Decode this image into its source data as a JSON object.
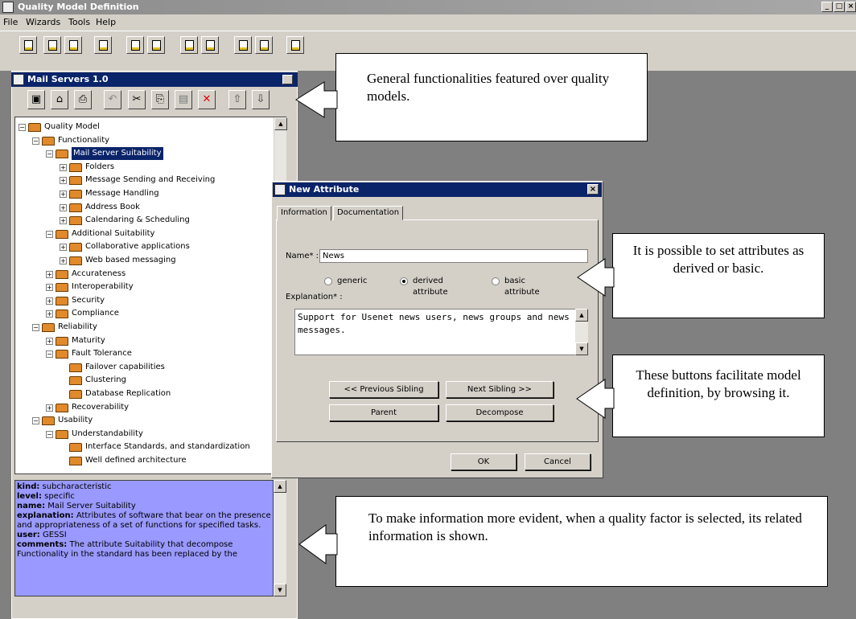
{
  "app": {
    "title": "Quality Model Definition",
    "window_buttons": [
      "_",
      "□",
      "×"
    ]
  },
  "menu": [
    "File",
    "Wizards",
    "Tools",
    "Help"
  ],
  "toolbar_icons": [
    "new-icon",
    "open-icon",
    "edit-icon",
    "edit-alt-icon",
    "page-icon",
    "image-icon",
    "copy-doc-icon",
    "paste-doc-icon",
    "check-doc-icon",
    "settings-icon",
    "book-icon"
  ],
  "inner_window": {
    "title": "Mail Servers 1.0",
    "toolbar": [
      {
        "name": "save-icon",
        "glyph": "▣"
      },
      {
        "name": "open-icon",
        "glyph": "⌂"
      },
      {
        "name": "print-icon",
        "glyph": "⎙"
      },
      {
        "name": "undo-icon",
        "glyph": "↶"
      },
      {
        "name": "cut-icon",
        "glyph": "✂"
      },
      {
        "name": "copy-icon",
        "glyph": "⎘"
      },
      {
        "name": "paste-icon",
        "glyph": "▤"
      },
      {
        "name": "delete-icon",
        "glyph": "✕"
      },
      {
        "name": "up-arrow-icon",
        "glyph": "⇧"
      },
      {
        "name": "down-arrow-icon",
        "glyph": "⇩"
      }
    ]
  },
  "tree": [
    {
      "label": "Quality Model",
      "level": 0,
      "pm": "−"
    },
    {
      "label": "Functionality",
      "level": 1,
      "pm": "−"
    },
    {
      "label": "Mail Server Suitability",
      "level": 2,
      "pm": "−",
      "selected": true
    },
    {
      "label": "Folders",
      "level": 3,
      "pm": "+"
    },
    {
      "label": "Message Sending and Receiving",
      "level": 3,
      "pm": "+"
    },
    {
      "label": "Message Handling",
      "level": 3,
      "pm": "+"
    },
    {
      "label": "Address Book",
      "level": 3,
      "pm": "+"
    },
    {
      "label": "Calendaring & Scheduling",
      "level": 3,
      "pm": "+"
    },
    {
      "label": "Additional Suitability",
      "level": 2,
      "pm": "−"
    },
    {
      "label": "Collaborative applications",
      "level": 3,
      "pm": "+"
    },
    {
      "label": "Web based messaging",
      "level": 3,
      "pm": "+"
    },
    {
      "label": "Accurateness",
      "level": 2,
      "pm": "+"
    },
    {
      "label": "Interoperability",
      "level": 2,
      "pm": "+"
    },
    {
      "label": "Security",
      "level": 2,
      "pm": "+"
    },
    {
      "label": "Compliance",
      "level": 2,
      "pm": "+"
    },
    {
      "label": "Reliability",
      "level": 1,
      "pm": "−"
    },
    {
      "label": "Maturity",
      "level": 2,
      "pm": "+"
    },
    {
      "label": "Fault Tolerance",
      "level": 2,
      "pm": "−"
    },
    {
      "label": "Failover capabilities",
      "level": 3,
      "pm": ""
    },
    {
      "label": "Clustering",
      "level": 3,
      "pm": ""
    },
    {
      "label": "Database Replication",
      "level": 3,
      "pm": ""
    },
    {
      "label": "Recoverability",
      "level": 2,
      "pm": "+"
    },
    {
      "label": "Usability",
      "level": 1,
      "pm": "−"
    },
    {
      "label": "Understandability",
      "level": 2,
      "pm": "−"
    },
    {
      "label": "Interface Standards, and standardization",
      "level": 3,
      "pm": ""
    },
    {
      "label": "Well defined architecture",
      "level": 3,
      "pm": ""
    }
  ],
  "info": [
    {
      "key": "kind:",
      "value": " subcharacteristic"
    },
    {
      "key": "level:",
      "value": " specific"
    },
    {
      "key": "name:",
      "value": " Mail Server Suitability"
    },
    {
      "key": "explanation:",
      "value": " Attributes of software that bear on the presence and appropriateness of a set of functions for specified tasks."
    },
    {
      "key": "user:",
      "value": " GESSI"
    },
    {
      "key": "comments:",
      "value": " The attribute Suitability that decompose Functionality in the standard has been replaced by the"
    }
  ],
  "dialog": {
    "title": "New Attribute",
    "close": "×",
    "tabs": [
      "Information",
      "Documentation"
    ],
    "name_label": "Name* :",
    "name_value": "News",
    "radio": [
      {
        "label": "generic",
        "checked": false
      },
      {
        "label": "derived attribute",
        "checked": true
      },
      {
        "label": "basic attribute",
        "checked": false
      }
    ],
    "explanation_label": "Explanation* :",
    "explanation_text": "Support for Usenet news users, news groups and news messages.",
    "buttons": {
      "prev": "<< Previous Sibling",
      "next": "Next Sibling >>",
      "parent": "Parent",
      "decompose": "Decompose",
      "ok": "OK",
      "cancel": "Cancel"
    }
  },
  "callouts": {
    "general": "General functionalities featured over quality models.",
    "attributes": "It is possible to set attributes as derived or basic.",
    "buttons": "These buttons facilitate model definition, by browsing it.",
    "info": "To make information more evident, when a quality factor is selected, its related information is shown."
  }
}
